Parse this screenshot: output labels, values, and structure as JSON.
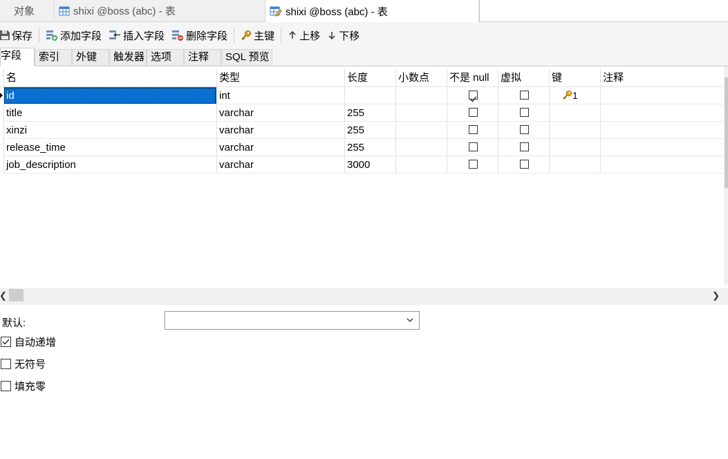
{
  "tabs": {
    "objects": "对象",
    "table_tab_1": "shixi @boss (abc) - 表",
    "table_tab_2": "shixi @boss (abc) - 表"
  },
  "toolbar": {
    "save": "保存",
    "add_field": "添加字段",
    "insert_field": "插入字段",
    "delete_field": "删除字段",
    "primary_key": "主键",
    "move_up": "上移",
    "move_down": "下移"
  },
  "subtabs": [
    "字段",
    "索引",
    "外键",
    "触发器",
    "选项",
    "注释",
    "SQL 预览"
  ],
  "grid": {
    "headers": {
      "name": "名",
      "type": "类型",
      "length": "长度",
      "decimals": "小数点",
      "not_null": "不是 null",
      "virtual": "虚拟",
      "key": "键",
      "comment": "注释"
    },
    "rows": [
      {
        "name": "id",
        "type": "int",
        "length": "",
        "decimals": "",
        "not_null": true,
        "virtual": false,
        "key": "1",
        "comment": ""
      },
      {
        "name": "title",
        "type": "varchar",
        "length": "255",
        "decimals": "",
        "not_null": false,
        "virtual": false,
        "key": "",
        "comment": ""
      },
      {
        "name": "xinzi",
        "type": "varchar",
        "length": "255",
        "decimals": "",
        "not_null": false,
        "virtual": false,
        "key": "",
        "comment": ""
      },
      {
        "name": "release_time",
        "type": "varchar",
        "length": "255",
        "decimals": "",
        "not_null": false,
        "virtual": false,
        "key": "",
        "comment": ""
      },
      {
        "name": "job_description",
        "type": "varchar",
        "length": "3000",
        "decimals": "",
        "not_null": false,
        "virtual": false,
        "key": "",
        "comment": ""
      }
    ]
  },
  "properties": {
    "default_label": "默认:",
    "default_value": "",
    "auto_increment": "自动递增",
    "auto_increment_checked": true,
    "unsigned": "无符号",
    "unsigned_checked": false,
    "zerofill": "填充零",
    "zerofill_checked": false
  }
}
